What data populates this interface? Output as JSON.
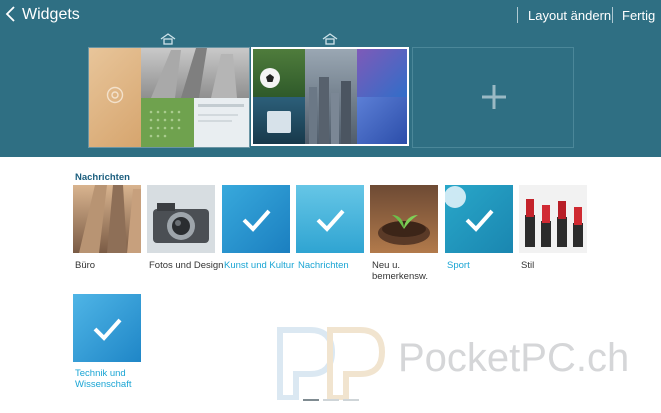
{
  "header": {
    "title": "Widgets",
    "layout_label": "Layout ändern",
    "done_label": "Fertig"
  },
  "section_title": "Nachrichten",
  "categories": [
    {
      "label": "Büro",
      "selected": false
    },
    {
      "label": "Fotos und Design",
      "selected": false
    },
    {
      "label": "Kunst und Kultur",
      "selected": true
    },
    {
      "label": "Nachrichten",
      "selected": true
    },
    {
      "label": "Neu u. bemerkensw.",
      "selected": false
    },
    {
      "label": "Sport",
      "selected": true
    },
    {
      "label": "Stil",
      "selected": false
    },
    {
      "label": "Technik und Wissenschaft",
      "selected": true
    }
  ],
  "watermark": "PocketPC.ch",
  "colors": {
    "header_bg": "#2f6f83",
    "accent": "#1aa5d4"
  }
}
